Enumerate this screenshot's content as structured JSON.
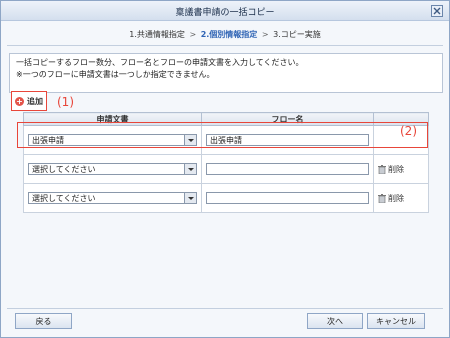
{
  "window": {
    "title": "稟議書申請の一括コピー",
    "close_icon": "close-icon"
  },
  "steps": {
    "step1": "1.共通情報指定",
    "sep1": ">",
    "step2": "2.個別情報指定",
    "sep2": ">",
    "step3": "3.コピー実施",
    "active_step": 2,
    "active_color": "#2f64b5"
  },
  "notice": {
    "line1": "一括コピーするフロー数分、フロー名とフローの申請文書を入力してください。",
    "line2": "※一つのフローに申請文書は一つしか指定できません。"
  },
  "toolbar": {
    "add_label": "追加",
    "add_icon": "plus-circle-icon"
  },
  "annotations": {
    "a1": "(1)",
    "a2": "(2)",
    "color": "#e8463a"
  },
  "table": {
    "headers": [
      "申請文書",
      "フロー名",
      ""
    ],
    "rows": [
      {
        "document": "出張申請",
        "flow_name": "出張申請",
        "delete_label": ""
      },
      {
        "document": "選択してください",
        "flow_name": "",
        "delete_label": "削除"
      },
      {
        "document": "選択してください",
        "flow_name": "",
        "delete_label": "削除"
      }
    ]
  },
  "footer": {
    "back": "戻る",
    "next": "次へ",
    "cancel": "キャンセル"
  }
}
